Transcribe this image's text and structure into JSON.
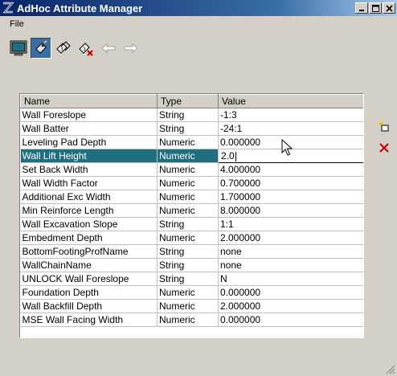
{
  "window": {
    "title": "AdHoc Attribute Manager"
  },
  "menu": {
    "items": [
      "File"
    ]
  },
  "toolbar": {
    "icons": [
      "monitor-icon",
      "attach-tag-icon",
      "tags-icon",
      "tag-remove-icon",
      "arrow-left-icon",
      "arrow-right-icon"
    ]
  },
  "table": {
    "columns": [
      "Name",
      "Type",
      "Value"
    ],
    "rows": [
      {
        "name": "Wall Foreslope",
        "type": "String",
        "value": "-1:3"
      },
      {
        "name": "Wall Batter",
        "type": "String",
        "value": "-24:1"
      },
      {
        "name": "Leveling Pad Depth",
        "type": "Numeric",
        "value": "0.000000"
      },
      {
        "name": "Wall Lift Height",
        "type": "Numeric",
        "value": "2.0"
      },
      {
        "name": "Set Back Width",
        "type": "Numeric",
        "value": "4.000000"
      },
      {
        "name": "Wall Width Factor",
        "type": "Numeric",
        "value": "0.700000"
      },
      {
        "name": "Additional Exc Width",
        "type": "Numeric",
        "value": "1.700000"
      },
      {
        "name": "Min Reinforce Length",
        "type": "Numeric",
        "value": "8.000000"
      },
      {
        "name": "Wall Excavation Slope",
        "type": "String",
        "value": "1:1"
      },
      {
        "name": "Embedment Depth",
        "type": "Numeric",
        "value": "2.000000"
      },
      {
        "name": "BottomFootingProfName",
        "type": "String",
        "value": "none"
      },
      {
        "name": "WallChainName",
        "type": "String",
        "value": "none"
      },
      {
        "name": "UNLOCK Wall Foreslope",
        "type": "String",
        "value": "N"
      },
      {
        "name": "Foundation Depth",
        "type": "Numeric",
        "value": "0.000000"
      },
      {
        "name": "Wall Backfill Depth",
        "type": "Numeric",
        "value": "2.000000"
      },
      {
        "name": "MSE Wall Facing Width",
        "type": "Numeric",
        "value": "0.000000"
      }
    ]
  },
  "colors": {
    "title_bar": "#0a246a",
    "selected_row": "#1f6f80",
    "delete_icon": "#c00000"
  }
}
